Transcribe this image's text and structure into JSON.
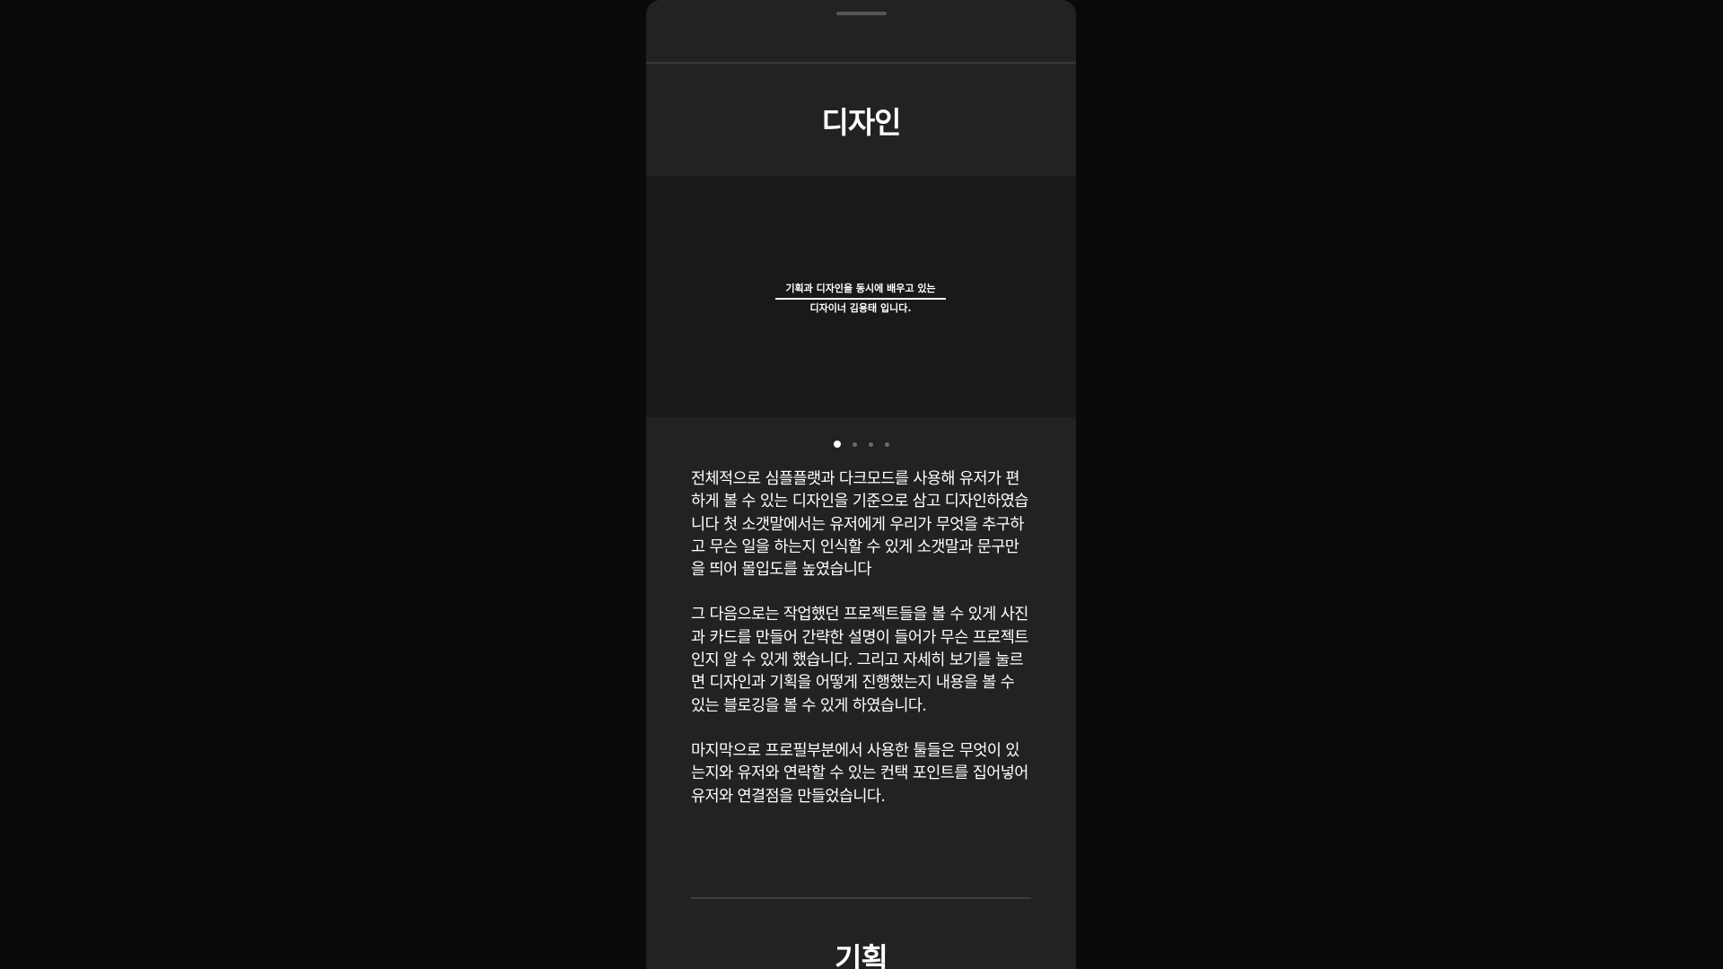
{
  "sections": {
    "design_title": "디자인",
    "plan_title": "기획"
  },
  "slider": {
    "caption_line1": "기획과 디자인을 동시에 배우고 있는",
    "caption_line2": "디자이너 김용태 입니다.",
    "dot_count": 4,
    "active_index": 0
  },
  "description": {
    "paragraphs": [
      "전체적으로 심플플랫과 다크모드를 사용해 유저가 편하게 볼 수 있는 디자인을 기준으로 삼고 디자인하였습니다 첫 소갯말에서는 유저에게 우리가 무엇을 추구하고 무슨 일을 하는지 인식할 수 있게 소갯말과 문구만을 띄어 몰입도를 높였습니다",
      "그 다음으로는 작업했던 프로젝트들을 볼 수 있게 사진과 카드를 만들어 간략한 설명이 들어가 무슨 프로젝트인지 알 수 있게 했습니다. 그리고 자세히 보기를 눌르면 디자인과 기획을 어떻게 진행했는지 내용을 볼 수 있는 블로깅을 볼 수 있게 하였습니다.",
      "마지막으로 프로필부분에서 사용한 툴들은 무엇이 있는지와 유저와 연락할 수 있는 컨택 포인트를 집어넣어 유저와 연결점을 만들었습니다."
    ]
  },
  "colors": {
    "page_background": "#0a0a0a",
    "sheet_background": "#222222",
    "slider_background": "#191919",
    "text": "#ffffff",
    "dot_inactive": "#6a6a6a"
  }
}
